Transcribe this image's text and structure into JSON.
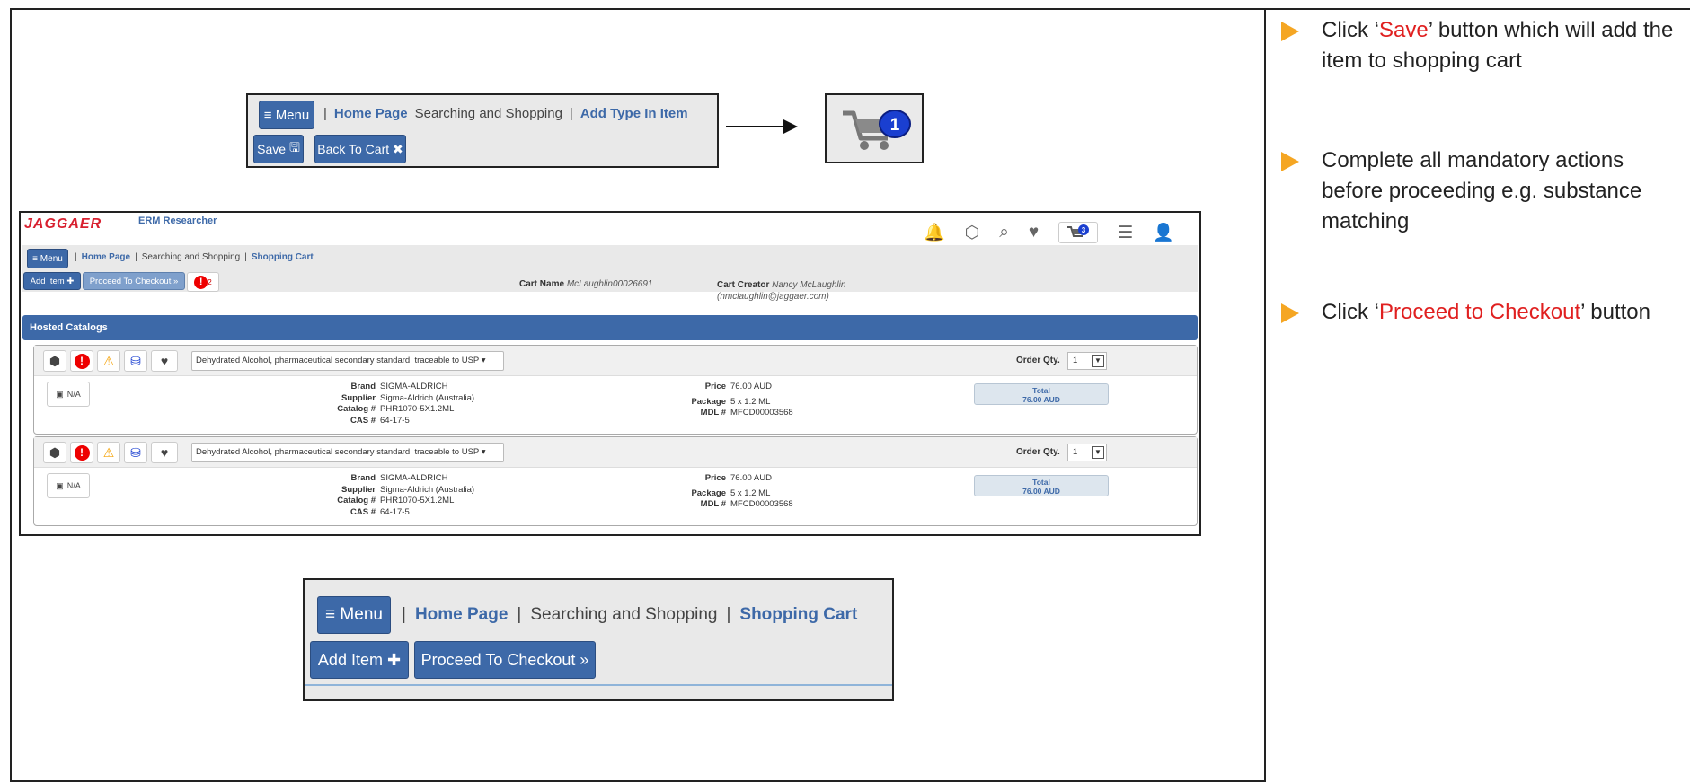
{
  "top_crumb": {
    "menu": "Menu",
    "home": "Home Page",
    "searching": "Searching and Shopping",
    "current": "Add Type In Item",
    "save": "Save",
    "back": "Back To Cart"
  },
  "cart_badge_count": "1",
  "shot": {
    "logo": "JAGGAER",
    "app_name": "ERM Researcher",
    "cart_icon_count": "3",
    "menu": "Menu",
    "home": "Home Page",
    "searching": "Searching and Shopping",
    "current": "Shopping Cart",
    "add_item": "Add Item",
    "proceed": "Proceed To Checkout",
    "alert_count": "2",
    "cart_name_label": "Cart Name",
    "cart_name_value": "McLaughlin00026691",
    "cart_creator_label": "Cart Creator",
    "cart_creator_value": "Nancy McLaughlin",
    "cart_creator_email": "(nmclaughlin@jaggaer.com)",
    "hosted_catalogs": "Hosted Catalogs",
    "items": [
      {
        "description": "Dehydrated Alcohol, pharmaceutical secondary standard; traceable to USP",
        "order_qty_label": "Order Qty.",
        "order_qty": "1",
        "na": "N/A",
        "brand_label": "Brand",
        "brand": "SIGMA-ALDRICH",
        "supplier_label": "Supplier",
        "supplier": "Sigma-Aldrich (Australia)",
        "catalog_label": "Catalog #",
        "catalog": "PHR1070-5X1.2ML",
        "cas_label": "CAS #",
        "cas": "64-17-5",
        "price_label": "Price",
        "price": "76.00 AUD",
        "package_label": "Package",
        "package": "5 x 1.2 ML",
        "mdl_label": "MDL #",
        "mdl": "MFCD00003568",
        "total_label": "Total",
        "total": "76.00 AUD"
      },
      {
        "description": "Dehydrated Alcohol, pharmaceutical secondary standard; traceable to USP",
        "order_qty_label": "Order Qty.",
        "order_qty": "1",
        "na": "N/A",
        "brand_label": "Brand",
        "brand": "SIGMA-ALDRICH",
        "supplier_label": "Supplier",
        "supplier": "Sigma-Aldrich (Australia)",
        "catalog_label": "Catalog #",
        "catalog": "PHR1070-5X1.2ML",
        "cas_label": "CAS #",
        "cas": "64-17-5",
        "price_label": "Price",
        "price": "76.00 AUD",
        "package_label": "Package",
        "package": "5 x 1.2 ML",
        "mdl_label": "MDL #",
        "mdl": "MFCD00003568",
        "total_label": "Total",
        "total": "76.00 AUD"
      }
    ]
  },
  "bottom_crumb": {
    "menu": "Menu",
    "home": "Home Page",
    "searching": "Searching and Shopping",
    "current": "Shopping Cart",
    "add_item": "Add Item",
    "proceed": "Proceed To Checkout"
  },
  "steps": [
    {
      "pre": "Click ‘",
      "red": "Save",
      "post": "’ button which will add the item to shopping cart"
    },
    {
      "pre": "Complete all mandatory actions before proceeding e.g. substance matching",
      "red": "",
      "post": ""
    },
    {
      "pre": "Click ‘",
      "red": "Proceed to Checkout",
      "post": "’ button"
    }
  ],
  "colors": {
    "primary": "#3d69a8",
    "accent_red": "#e02020",
    "bullet": "#f5a623"
  }
}
